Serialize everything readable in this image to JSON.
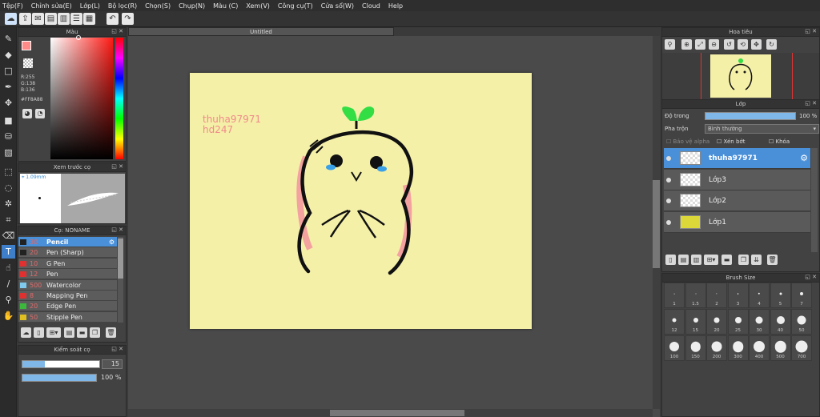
{
  "menu": [
    "Tệp(F)",
    "Chỉnh sửa(E)",
    "Lớp(L)",
    "Bộ lọc(R)",
    "Chọn(S)",
    "Chụp(N)",
    "Màu (C)",
    "Xem(V)",
    "Công cụ(T)",
    "Cửa sổ(W)",
    "Cloud",
    "Help"
  ],
  "document_title": "Untitled",
  "color_panel": {
    "title": "Màu",
    "r": "R:255",
    "g": "G:138",
    "b": "B:136",
    "hex": "#FF8A88"
  },
  "brush_preview": {
    "title": "Xem trước cọ",
    "size": "1.09mm"
  },
  "brush_list": {
    "title": "Cọ: NONAME",
    "items": [
      {
        "size": "30",
        "name": "Pencil",
        "color": "#222222",
        "selected": true
      },
      {
        "size": "20",
        "name": "Pen (Sharp)",
        "color": "#222222"
      },
      {
        "size": "10",
        "name": "G Pen",
        "color": "#e03030"
      },
      {
        "size": "12",
        "name": "Pen",
        "color": "#e03030"
      },
      {
        "size": "500",
        "name": "Watercolor",
        "color": "#7fc8ee"
      },
      {
        "size": "8",
        "name": "Mapping Pen",
        "color": "#e03030"
      },
      {
        "size": "20",
        "name": "Edge Pen",
        "color": "#3cb83c"
      },
      {
        "size": "50",
        "name": "Stipple Pen",
        "color": "#e0c020"
      }
    ]
  },
  "brush_control": {
    "title": "Kiểm soát cọ",
    "size_value": "15",
    "opacity_value": "100 %"
  },
  "canvas_text": [
    "thuha97971",
    "hd247"
  ],
  "navigator": {
    "title": "Hoa tiêu"
  },
  "layers": {
    "title": "Lớp",
    "opacity_label": "Độ trong",
    "opacity_value": "100 %",
    "blend_label": "Pha trộn",
    "blend_value": "Bình thường",
    "protect_alpha": "Bảo vệ alpha",
    "clipping": "Xén bớt",
    "lock": "Khóa",
    "items": [
      {
        "name": "thuha97971",
        "selected": true
      },
      {
        "name": "Lớp3"
      },
      {
        "name": "Lớp2"
      },
      {
        "name": "Lớp1"
      }
    ]
  },
  "brush_size": {
    "title": "Brush Size",
    "sizes": [
      "1",
      "1.5",
      "2",
      "3",
      "4",
      "5",
      "7",
      "12",
      "15",
      "20",
      "25",
      "30",
      "40",
      "50",
      "100",
      "150",
      "200",
      "300",
      "400",
      "500",
      "700"
    ]
  },
  "colors": {
    "accent": "#4a90d9",
    "canvas": "#f5f0a8",
    "stroke": "#111111",
    "cheek": "#f4a2a0",
    "leaf": "#33dd44",
    "tear": "#3aa0e8",
    "watermark": "#f08a8a"
  }
}
